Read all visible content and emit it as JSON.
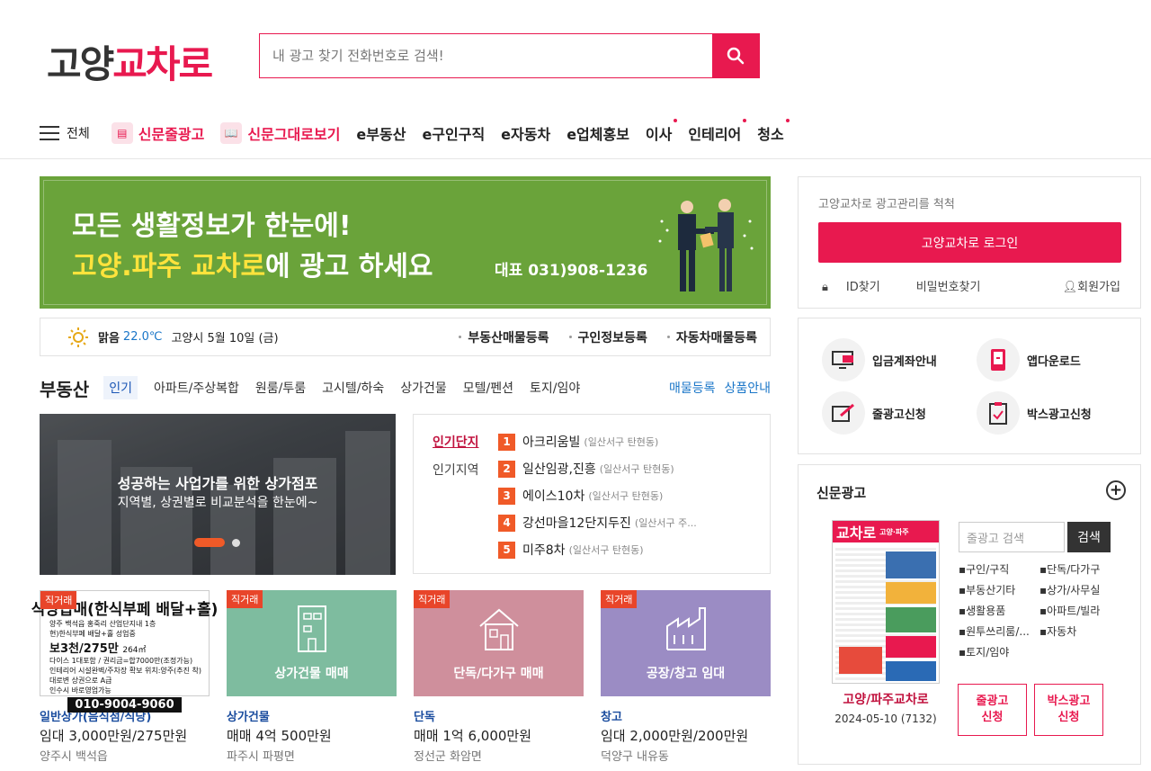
{
  "header": {
    "logo_part1": "고양",
    "logo_part2": "교차로",
    "search_placeholder": "내 광고 찾기 전화번호로 검색!",
    "brand_color": "#e8194f"
  },
  "nav": {
    "all_label": "전체",
    "newspaper_ad": "신문줄광고",
    "newspaper_view": "신문그대로보기",
    "items": [
      "e부동산",
      "e구인구직",
      "e자동차",
      "e업체홍보",
      "이사",
      "인테리어",
      "청소"
    ]
  },
  "banner": {
    "line1": "모든 생활정보가 한눈에!",
    "line2_highlight": "고양.파주 교차로",
    "line2_rest": "에 광고 하세요",
    "tel": "대표 031)908-1236",
    "bg_color": "#6aa33a"
  },
  "weather": {
    "condition": "맑음",
    "temp": "22.0℃",
    "location_date": "고양시 5월 10일 (금)",
    "links": [
      "부동산매물등록",
      "구인정보등록",
      "자동차매물등록"
    ]
  },
  "realestate": {
    "title": "부동산",
    "tabs": [
      "인기",
      "아파트/주상복합",
      "원룸/투룸",
      "고시텔/하숙",
      "상가건물",
      "모텔/펜션",
      "토지/임야"
    ],
    "right_links": [
      "매물등록",
      "상품안내"
    ],
    "hero_title": "성공하는 사업가를 위한 상가점포",
    "hero_sub": "지역별, 상권별로 비교분석을 한눈에~",
    "popular_label1": "인기단지",
    "popular_label2": "인기지역",
    "popular": [
      {
        "rank": "1",
        "name": "아크리움빌",
        "loc": "(일산서구 탄현동)"
      },
      {
        "rank": "2",
        "name": "일산임광,진흥",
        "loc": "(일산서구 탄현동)"
      },
      {
        "rank": "3",
        "name": "에이스10차",
        "loc": "(일산서구 탄현동)"
      },
      {
        "rank": "4",
        "name": "강선마을12단지두진",
        "loc": "(일산서구 주..."
      },
      {
        "rank": "5",
        "name": "미주8차",
        "loc": "(일산서구 탄현동)"
      }
    ],
    "cards": [
      {
        "badge": "직거래",
        "img_label": "",
        "category": "일반상가(음식점/식당)",
        "price": "임대 3,000만원/275만원",
        "location": "양주시 백석읍",
        "ad_head": "식당급매(한식부페 배달+홀)",
        "ad_lines": [
          "양주 백석읍 홍죽리 산업단지내 1층",
          "현)한식부페 배달+홀 성업중",
          "다이스 1대포함 / 권리금=합7000만(조정가능)",
          "인테리어 시설완벽/주차장 확보 위치:양주(추진 착)",
          "대로변 상권으로 A급",
          "인수시 바로영업가능"
        ],
        "ad_big": "보3천/275만",
        "ad_small": "264㎡",
        "ad_phone": "010-9004-9060"
      },
      {
        "badge": "직거래",
        "img_label": "상가건물 매매",
        "category": "상가건물",
        "price": "매매 4억 500만원",
        "location": "파주시 파평면",
        "color": "#7ebc9f"
      },
      {
        "badge": "직거래",
        "img_label": "단독/다가구 매매",
        "category": "단독",
        "price": "매매 1억 6,000만원",
        "location": "정선군 화암면",
        "color": "#cf8f9c"
      },
      {
        "badge": "직거래",
        "img_label": "공장/창고 임대",
        "category": "창고",
        "price": "임대 2,000만원/200만원",
        "location": "덕양구 내유동",
        "color": "#9b8cc4"
      }
    ]
  },
  "login": {
    "text": "고양교차로 광고관리를 척척",
    "button": "고양교차로 로그인",
    "id_find": "ID찾기",
    "pw_find": "비밀번호찾기",
    "signup": "회원가입"
  },
  "services": [
    "입금계좌안내",
    "앱다운로드",
    "줄광고신청",
    "박스광고신청"
  ],
  "newspaper": {
    "title": "신문광고",
    "paper_name": "고양/파주교차로",
    "paper_date": "2024-05-10 (7132)",
    "paper_masthead": "교차로",
    "paper_head_sub": "고양·파주",
    "search_placeholder": "줄광고 검색",
    "search_btn": "검색",
    "categories": [
      "구인/구직",
      "단독/다가구",
      "부동산기타",
      "상가/사무실",
      "생활용품",
      "아파트/빌라",
      "원투쓰리룸/...",
      "자동차",
      "토지/임야"
    ],
    "btn1": "줄광고\n신청",
    "btn2": "박스광고\n신청"
  }
}
